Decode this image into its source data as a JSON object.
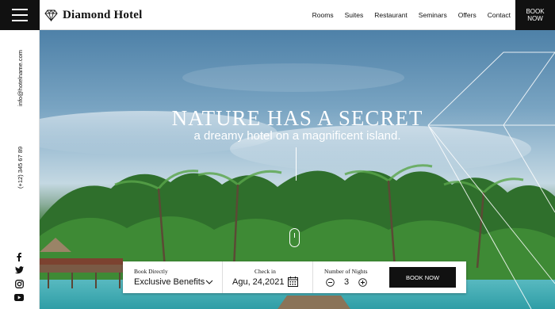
{
  "header": {
    "brand": "Diamond Hotel",
    "nav": [
      "Rooms",
      "Suites",
      "Restaurant",
      "Seminars",
      "Offers",
      "Contact"
    ],
    "book_now_line1": "BOOK",
    "book_now_line2": "NOW"
  },
  "sidebar": {
    "email": "info@hotelname.com",
    "phone": "(+12) 345 67 89"
  },
  "hero": {
    "headline": "NATURE HAS A SECRET",
    "subline": "a dreamy hotel on a magnificent island."
  },
  "booking": {
    "book_directly_label": "Book Directly",
    "book_directly_value": "Exclusive Benefits",
    "checkin_label": "Check in",
    "checkin_value": "Agu, 24,2021",
    "nights_label": "Number of Nights",
    "nights_value": "3",
    "button_label": "BOOK NOW"
  },
  "colors": {
    "dark": "#111111",
    "white": "#ffffff"
  }
}
